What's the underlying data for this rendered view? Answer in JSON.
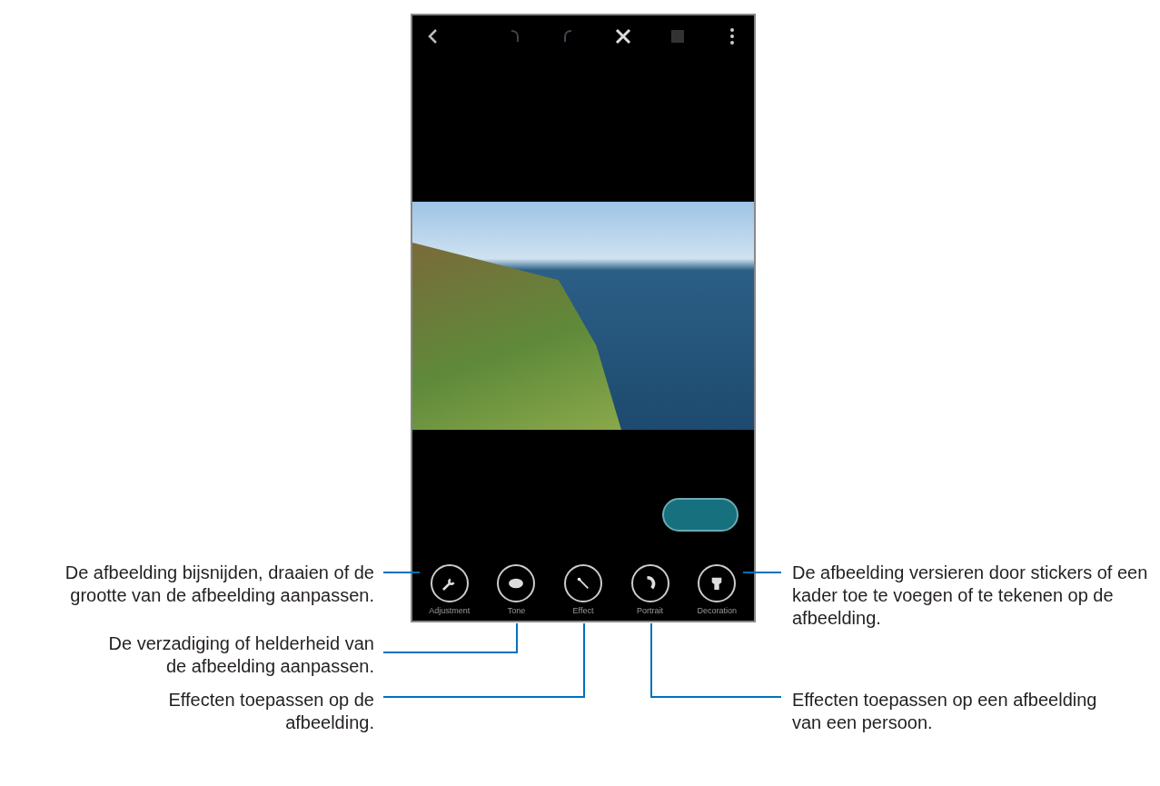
{
  "phone": {
    "top_bar": [
      {
        "kind": "back"
      },
      {
        "kind": "undo"
      },
      {
        "kind": "redo"
      },
      {
        "kind": "close"
      },
      {
        "kind": "save"
      },
      {
        "kind": "more"
      }
    ],
    "tools": [
      {
        "label": "Adjustment",
        "kind": "wrench"
      },
      {
        "label": "Tone",
        "kind": "palette"
      },
      {
        "label": "Effect",
        "kind": "wand"
      },
      {
        "label": "Portrait",
        "kind": "portrait"
      },
      {
        "label": "Decoration",
        "kind": "decoration"
      }
    ]
  },
  "left_callouts": [
    {
      "text": "De afbeelding bijsnijden, draaien of de grootte van de afbeelding aanpassen."
    },
    {
      "text": "De verzadiging of helderheid van de afbeelding aanpassen."
    },
    {
      "text": "Effecten toepassen op de afbeelding."
    }
  ],
  "right_callouts": [
    {
      "text": "De afbeelding versieren door stickers of een kader toe te voegen of te tekenen op de afbeelding."
    },
    {
      "text": "Effecten toepassen op een afbeelding van een persoon."
    }
  ]
}
